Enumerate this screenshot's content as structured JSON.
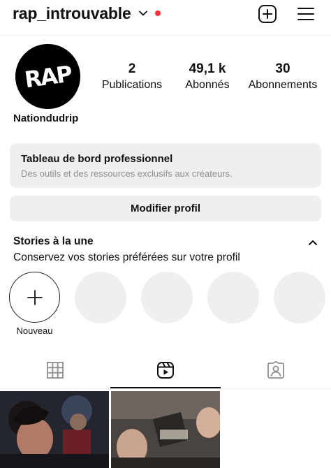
{
  "header": {
    "username": "rap_introuvable",
    "username_menu_icon": "chevron-down-icon",
    "notification_dot_color": "#ff3040",
    "create_icon": "plus-square-icon",
    "menu_icon": "hamburger-menu-icon"
  },
  "profile": {
    "avatar_text": "RAP",
    "display_name": "Nationdudrip",
    "stats": [
      {
        "value": "2",
        "label": "Publications"
      },
      {
        "value": "49,1 k",
        "label": "Abonnés"
      },
      {
        "value": "30",
        "label": "Abonnements"
      }
    ]
  },
  "pro_dashboard": {
    "title": "Tableau de bord professionnel",
    "subtitle": "Des outils et des ressources exclusifs aux créateurs."
  },
  "actions": {
    "edit_profile": "Modifier profil"
  },
  "stories": {
    "title": "Stories à la une",
    "subtitle": "Conservez vos stories préférées sur votre profil",
    "new_label": "Nouveau",
    "collapse_icon": "chevron-up-icon"
  },
  "tabs": [
    {
      "name": "grid",
      "icon": "grid-icon",
      "active": false
    },
    {
      "name": "reels",
      "icon": "reels-icon",
      "active": true
    },
    {
      "name": "tagged",
      "icon": "tagged-user-icon",
      "active": false
    }
  ],
  "posts_count_visible": 2
}
